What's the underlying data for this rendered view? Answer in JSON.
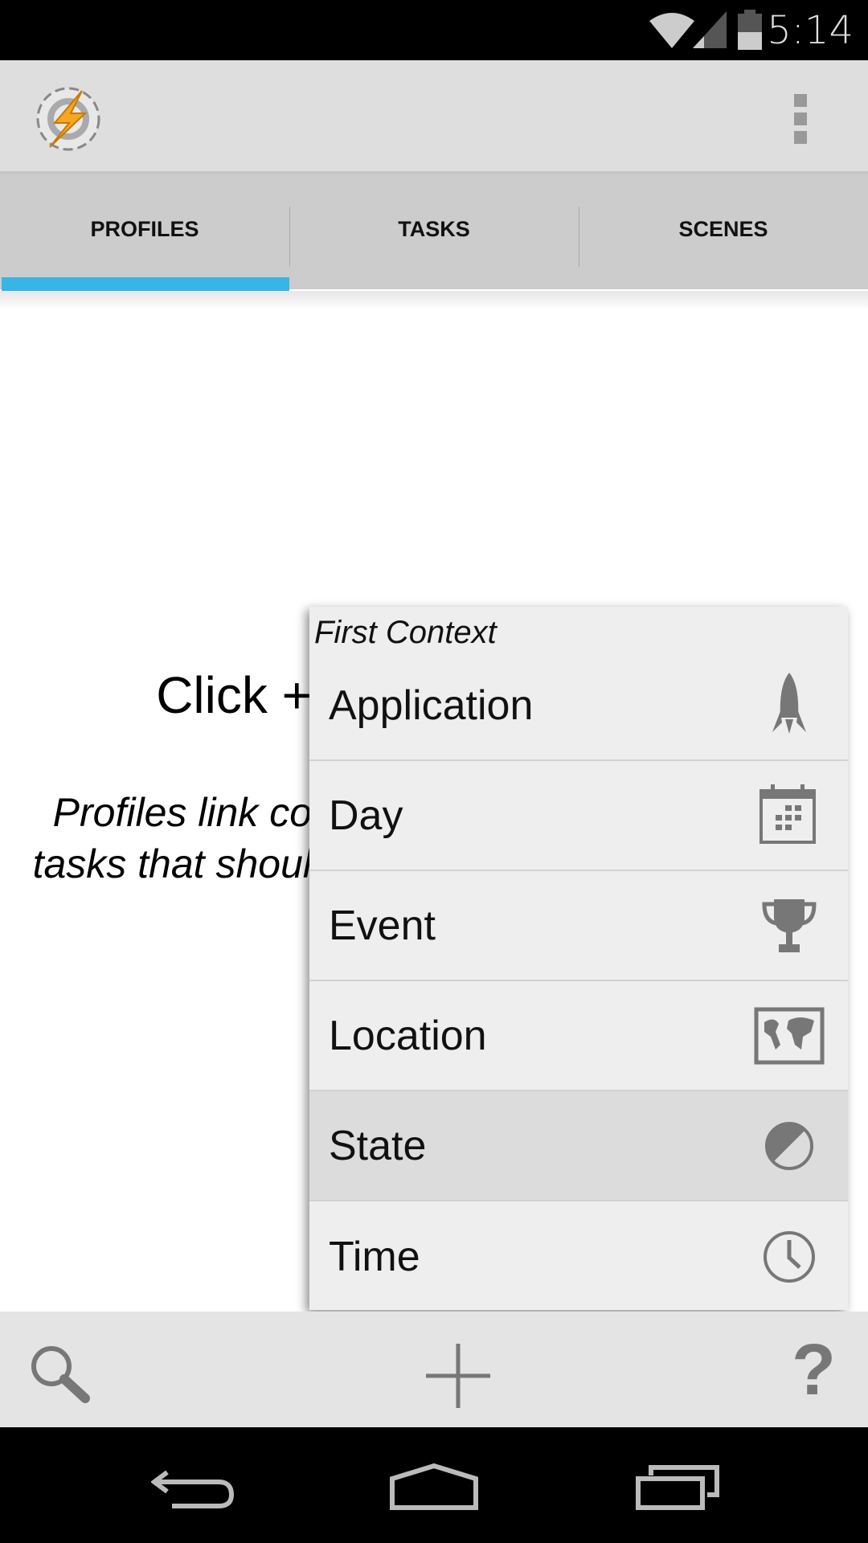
{
  "status_bar": {
    "time": "5:14",
    "icons": [
      "wifi-icon",
      "signal-icon",
      "battery-icon"
    ]
  },
  "action_bar": {
    "logo": "tasker-logo",
    "menu_icon": "overflow-menu-icon"
  },
  "tabs": [
    {
      "label": "PROFILES",
      "active": true
    },
    {
      "label": "TASKS",
      "active": false
    },
    {
      "label": "SCENES",
      "active": false
    }
  ],
  "accent": "#37b5e5",
  "content": {
    "hint_visible": "Click +",
    "desc_line1_visible": "Profiles link co",
    "desc_line2_visible": "tasks that shoul"
  },
  "popup": {
    "title": "First Context",
    "items": [
      {
        "label": "Application",
        "icon": "rocket-icon"
      },
      {
        "label": "Day",
        "icon": "calendar-icon"
      },
      {
        "label": "Event",
        "icon": "trophy-icon"
      },
      {
        "label": "Location",
        "icon": "map-icon"
      },
      {
        "label": "State",
        "icon": "half-circle-icon",
        "highlighted": true
      },
      {
        "label": "Time",
        "icon": "clock-icon"
      }
    ]
  },
  "bottom_bar": {
    "icons": [
      "search-icon",
      "add-icon",
      "help-icon"
    ]
  },
  "nav_bar": {
    "icons": [
      "back-icon",
      "home-icon",
      "recents-icon"
    ]
  }
}
